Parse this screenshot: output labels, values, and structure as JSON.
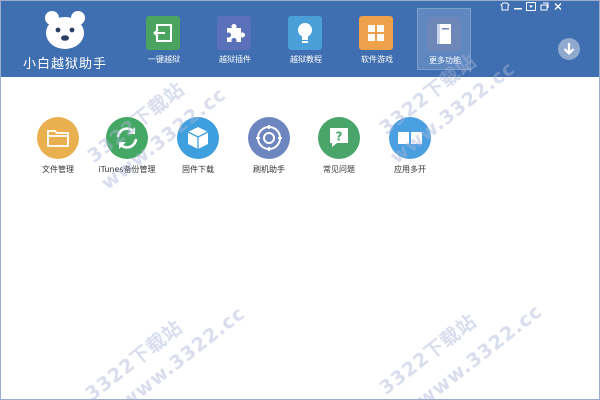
{
  "app": {
    "title": "小白越狱助手",
    "logo_icon": "bear-icon",
    "header_color": "#3f6fb0"
  },
  "nav": {
    "items": [
      {
        "label": "一键越狱",
        "icon": "exit-icon",
        "color": "#4aa45f",
        "active": false
      },
      {
        "label": "越狱插件",
        "icon": "puzzle-icon",
        "color": "#5a70b8",
        "active": false
      },
      {
        "label": "越狱教程",
        "icon": "lightbulb-icon",
        "color": "#4a9fd8",
        "active": false
      },
      {
        "label": "软件游戏",
        "icon": "grid-icon",
        "color": "#eea04a",
        "active": false
      },
      {
        "label": "更多功能",
        "icon": "book-icon",
        "color": "#6e86b8",
        "active": true
      }
    ]
  },
  "window_controls": {
    "items": [
      {
        "name": "skin",
        "icon": "skin-icon"
      },
      {
        "name": "minimize",
        "icon": "minimize-icon"
      },
      {
        "name": "menu",
        "icon": "menu-icon"
      },
      {
        "name": "restore",
        "icon": "restore-icon"
      },
      {
        "name": "close",
        "icon": "close-icon"
      }
    ]
  },
  "download": {
    "icon": "arrow-down-icon"
  },
  "tools": {
    "items": [
      {
        "label": "文件管理",
        "icon": "folder-icon",
        "color": "#e9b04f"
      },
      {
        "label": "iTunes备份管理",
        "icon": "sync-icon",
        "color": "#44a864"
      },
      {
        "label": "固件下载",
        "icon": "box-icon",
        "color": "#3e9fde"
      },
      {
        "label": "刷机助手",
        "icon": "gear-icon",
        "color": "#6e86c0"
      },
      {
        "label": "常见问题",
        "icon": "question-icon",
        "color": "#4aa56a"
      },
      {
        "label": "应用多开",
        "icon": "windows-icon",
        "color": "#4a9fe0"
      }
    ]
  },
  "watermark": {
    "lines": [
      "3322下载站",
      "www.3322.cc"
    ]
  }
}
